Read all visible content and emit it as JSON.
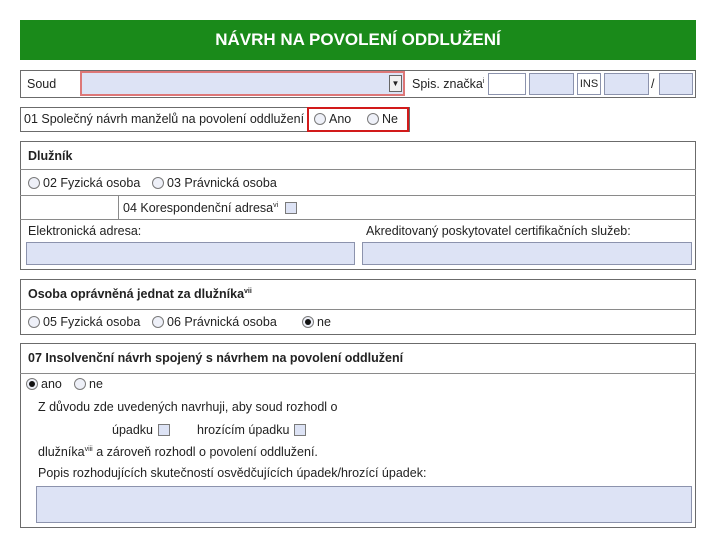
{
  "title": "NÁVRH NA POVOLENÍ ODDLUŽENÍ",
  "court": {
    "label": "Soud",
    "file_mark_label": "Spis. značka",
    "file_mark_sup": "i",
    "ins_label": "INS",
    "slash": "/",
    "dropdown_icon": "▼"
  },
  "joint": {
    "label": "01 Společný návrh manželů na povolení oddlužení",
    "yes": "Ano",
    "no": "Ne"
  },
  "debtor": {
    "heading": "Dlužník",
    "natural": "02 Fyzická osoba",
    "legal": "03 Právnická osoba",
    "corr_label": "04 Korespondenční adresa",
    "corr_sup": "vi",
    "email_label": "Elektronická adresa:",
    "cert_label": "Akreditovaný poskytovatel certifikačních služeb:"
  },
  "representative": {
    "heading": "Osoba oprávněná jednat za dlužníka",
    "heading_sup": "vii",
    "natural": "05 Fyzická osoba",
    "legal": "06 Právnická osoba",
    "none": "ne",
    "selected": "ne"
  },
  "insolvency": {
    "heading": "07 Insolvenční návrh spojený s návrhem na povolení oddlužení",
    "yes": "ano",
    "no": "ne",
    "selected": "ano",
    "line1": "Z důvodu zde uvedených navrhuji, aby soud rozhodl o",
    "bankruptcy": "úpadku",
    "imminent": "hrozícím úpadku",
    "line3_a": "dlužníka",
    "line3_sup": "viii",
    "line3_b": " a zároveň rozhodl o povolení oddlužení.",
    "desc_label": "Popis rozhodujících skutečností osvědčujících úpadek/hrozící úpadek:"
  },
  "colors": {
    "title_bg": "#1a8a1a",
    "field_bg": "#dde3f5",
    "highlight": "#d21a1a"
  }
}
